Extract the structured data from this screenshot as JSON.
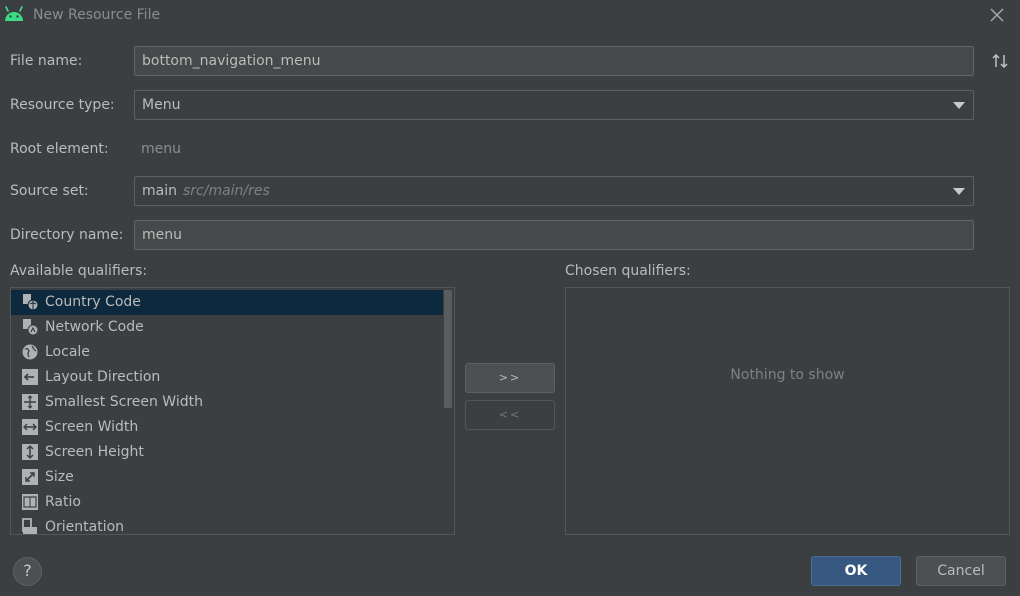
{
  "window": {
    "title": "New Resource File",
    "icon": "android-icon",
    "close_icon": "close-icon"
  },
  "form": {
    "file_name": {
      "label": "File name:",
      "value": "bottom_navigation_menu"
    },
    "resource_type": {
      "label": "Resource type:",
      "value": "Menu"
    },
    "root_element": {
      "label": "Root element:",
      "value": "menu"
    },
    "source_set": {
      "label": "Source set:",
      "value": "main",
      "hint": "src/main/res"
    },
    "directory_name": {
      "label": "Directory name:",
      "value": "menu"
    }
  },
  "qualifiers": {
    "available_label": "Available qualifiers:",
    "chosen_label": "Chosen qualifiers:",
    "empty_text": "Nothing to show",
    "add_label": ">>",
    "remove_label": "<<",
    "items": [
      {
        "label": "Country Code",
        "icon": "country-code-icon",
        "selected": true
      },
      {
        "label": "Network Code",
        "icon": "network-code-icon",
        "selected": false
      },
      {
        "label": "Locale",
        "icon": "globe-icon",
        "selected": false
      },
      {
        "label": "Layout Direction",
        "icon": "layout-direction-icon",
        "selected": false
      },
      {
        "label": "Smallest Screen Width",
        "icon": "smallest-width-icon",
        "selected": false
      },
      {
        "label": "Screen Width",
        "icon": "screen-width-icon",
        "selected": false
      },
      {
        "label": "Screen Height",
        "icon": "screen-height-icon",
        "selected": false
      },
      {
        "label": "Size",
        "icon": "size-icon",
        "selected": false
      },
      {
        "label": "Ratio",
        "icon": "ratio-icon",
        "selected": false
      },
      {
        "label": "Orientation",
        "icon": "orientation-icon",
        "selected": false
      }
    ]
  },
  "buttons": {
    "help": "?",
    "ok": "OK",
    "cancel": "Cancel"
  },
  "colors": {
    "background": "#3c3f41",
    "selection": "#0d293e",
    "accent_button": "#365880",
    "android_green": "#3ddc84"
  }
}
